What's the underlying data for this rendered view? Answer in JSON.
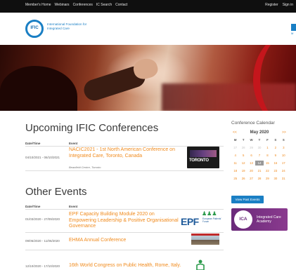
{
  "topbar": {
    "nav": [
      "Member's Home",
      "Webinars",
      "Conferences",
      "IC Search",
      "Contact"
    ],
    "register": "Register",
    "sign_in": "Sign in"
  },
  "header": {
    "logo_text": "IFIC",
    "org_name": "International Foundation for Integrated Care"
  },
  "upcoming": {
    "title": "Upcoming IFIC Conferences",
    "col_date": "Date/Time",
    "col_event": "Event",
    "events": [
      {
        "date": "04/10/2021 - 06/10/2021",
        "title": "NACIC2021 - 1st North American Conference on Integrated Care, Toronto, Canada",
        "venue": "Beanfield Centre, Toronto",
        "thumb_label": "TORONTO"
      }
    ]
  },
  "other": {
    "title": "Other Events",
    "col_date": "Date/Time",
    "col_event": "Event",
    "events": [
      {
        "date": "01/03/2020 - 27/09/2020",
        "title": "EPF Capacity Building Module 2020 on Empowering Leadership & Positive Organisational Governance"
      },
      {
        "date": "09/06/2020 - 11/06/2020",
        "title": "EHMA Annual Conference"
      },
      {
        "date": "12/10/2020 - 17/10/2020",
        "title": "16th World Congress on Public Health, Rome, Italy."
      }
    ],
    "epf_logo": {
      "letters": "EPF",
      "small": "European Patients' Forum"
    }
  },
  "calendar": {
    "title": "Conference Calendar",
    "prev": "<<",
    "next": ">>",
    "month": "May 2020",
    "dow": [
      "M",
      "T",
      "W",
      "T",
      "F",
      "S",
      "S"
    ],
    "days": [
      [
        "27",
        "28",
        "29",
        "30",
        "1",
        "2",
        "3"
      ],
      [
        "4",
        "5",
        "6",
        "7",
        "8",
        "9",
        "10"
      ],
      [
        "11",
        "12",
        "13",
        "14",
        "15",
        "16",
        "17"
      ],
      [
        "18",
        "19",
        "20",
        "21",
        "22",
        "23",
        "24"
      ],
      [
        "25",
        "26",
        "27",
        "28",
        "29",
        "30",
        "31"
      ]
    ],
    "today": "14"
  },
  "sidebar": {
    "past_events_button": "View Past Events",
    "ica_logo": "ICA",
    "ica_text": "Integrated Care Academy"
  },
  "colors": {
    "accent_orange": "#f08a1c",
    "brand_blue": "#1a7fc4",
    "topbar": "#0f0f0f"
  }
}
